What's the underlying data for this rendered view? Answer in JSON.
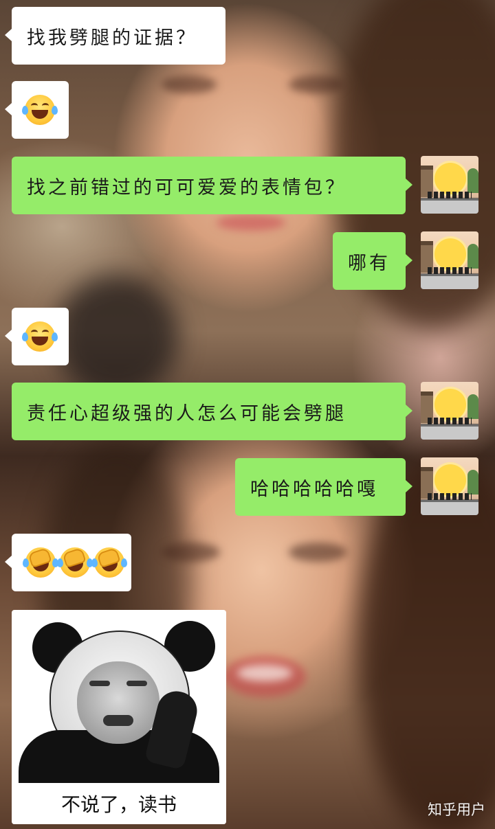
{
  "messages": [
    {
      "side": "left",
      "type": "text",
      "text": "找我劈腿的证据？"
    },
    {
      "side": "left",
      "type": "emoji",
      "emoji": "face-with-tears-of-joy"
    },
    {
      "side": "right",
      "type": "text",
      "text": "找之前错过的可可爱爱的表情包？"
    },
    {
      "side": "right",
      "type": "text",
      "text": "哪有"
    },
    {
      "side": "left",
      "type": "emoji",
      "emoji": "face-with-tears-of-joy"
    },
    {
      "side": "right",
      "type": "text",
      "text": "责任心超级强的人怎么可能会劈腿"
    },
    {
      "side": "right",
      "type": "text",
      "text": "哈哈哈哈哈嘎"
    },
    {
      "side": "left",
      "type": "emoji",
      "emoji": "face-palm-tears",
      "count": 3
    },
    {
      "side": "left",
      "type": "sticker",
      "caption": "不说了，读书"
    }
  ],
  "watermark": "知乎用户",
  "colors": {
    "sent_bubble": "#95ec69",
    "received_bubble": "#ffffff"
  }
}
